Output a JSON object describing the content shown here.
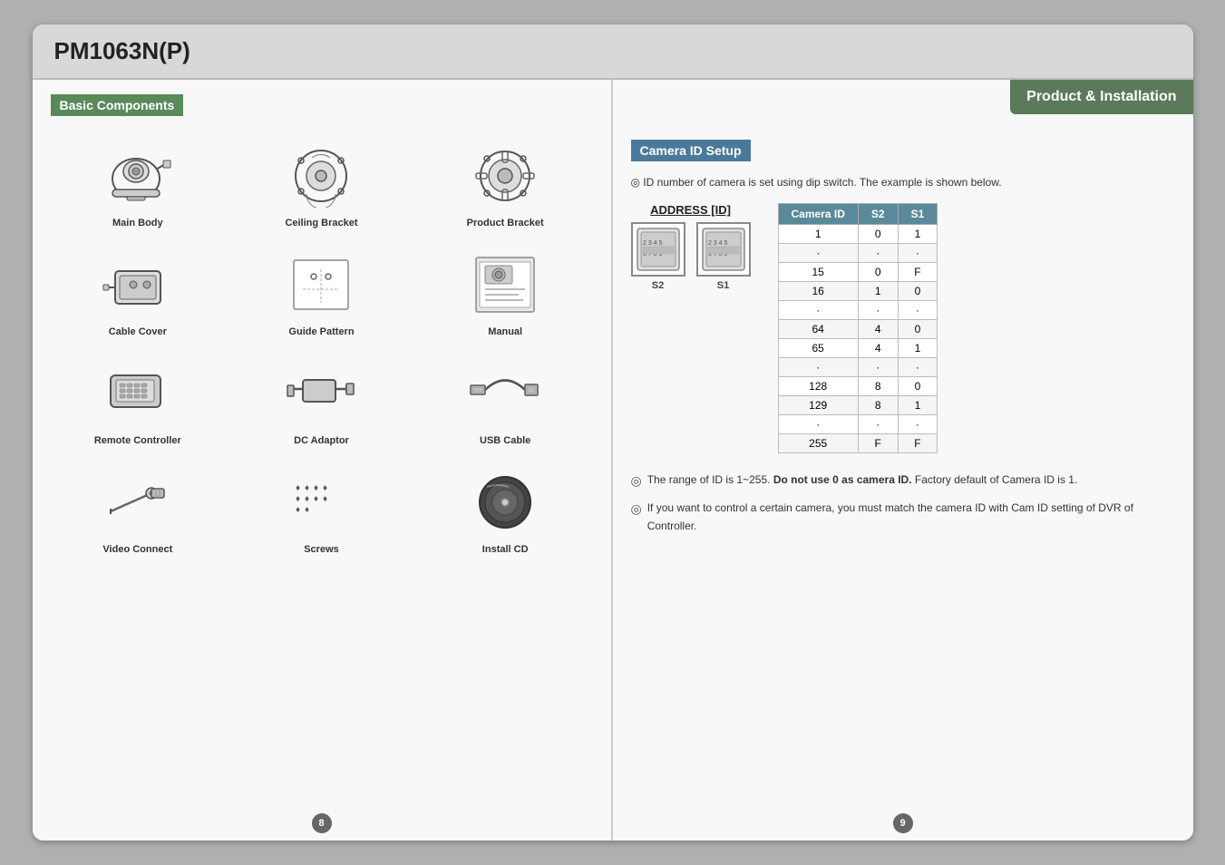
{
  "model": {
    "title": "PM1063N(P)"
  },
  "left_page": {
    "section_title": "Basic Components",
    "components": [
      {
        "id": "main-body",
        "label": "Main Body"
      },
      {
        "id": "ceiling-bracket",
        "label": "Ceiling Bracket"
      },
      {
        "id": "product-bracket",
        "label": "Product Bracket"
      },
      {
        "id": "cable-cover",
        "label": "Cable Cover"
      },
      {
        "id": "guide-pattern",
        "label": "Guide Pattern"
      },
      {
        "id": "manual",
        "label": "Manual"
      },
      {
        "id": "remote-controller",
        "label": "Remote Controller"
      },
      {
        "id": "dc-adaptor",
        "label": "DC Adaptor"
      },
      {
        "id": "usb-cable",
        "label": "USB Cable"
      },
      {
        "id": "video-connect",
        "label": "Video Connect"
      },
      {
        "id": "screws",
        "label": "Screws"
      },
      {
        "id": "install-cd",
        "label": "Install CD"
      }
    ],
    "page_number": "8"
  },
  "right_page": {
    "badge": "Product & Installation",
    "section_title": "Camera ID Setup",
    "description": "◎ ID number of camera is set using dip switch. The example is shown below.",
    "address_label": "ADDRESS [ID]",
    "switch_labels": [
      "S2",
      "S1"
    ],
    "table": {
      "headers": [
        "Camera ID",
        "S2",
        "S1"
      ],
      "rows": [
        [
          "1",
          "0",
          "1"
        ],
        [
          "·",
          "·",
          "·"
        ],
        [
          "15",
          "0",
          "F"
        ],
        [
          "16",
          "1",
          "0"
        ],
        [
          "·",
          "·",
          "·"
        ],
        [
          "64",
          "4",
          "0"
        ],
        [
          "65",
          "4",
          "1"
        ],
        [
          "·",
          "·",
          "·"
        ],
        [
          "128",
          "8",
          "0"
        ],
        [
          "129",
          "8",
          "1"
        ],
        [
          "·",
          "·",
          "·"
        ],
        [
          "255",
          "F",
          "F"
        ]
      ]
    },
    "notes": [
      {
        "bullet": "◎",
        "text": "The range of ID is 1~255. ",
        "bold": "Do not use 0 as camera ID.",
        "text2": " Factory default of Camera ID is 1."
      },
      {
        "bullet": "◎",
        "text": "If you want to control a certain camera, you must match the camera ID with Cam ID setting of DVR of Controller.",
        "bold": "",
        "text2": ""
      }
    ],
    "page_number": "9"
  }
}
